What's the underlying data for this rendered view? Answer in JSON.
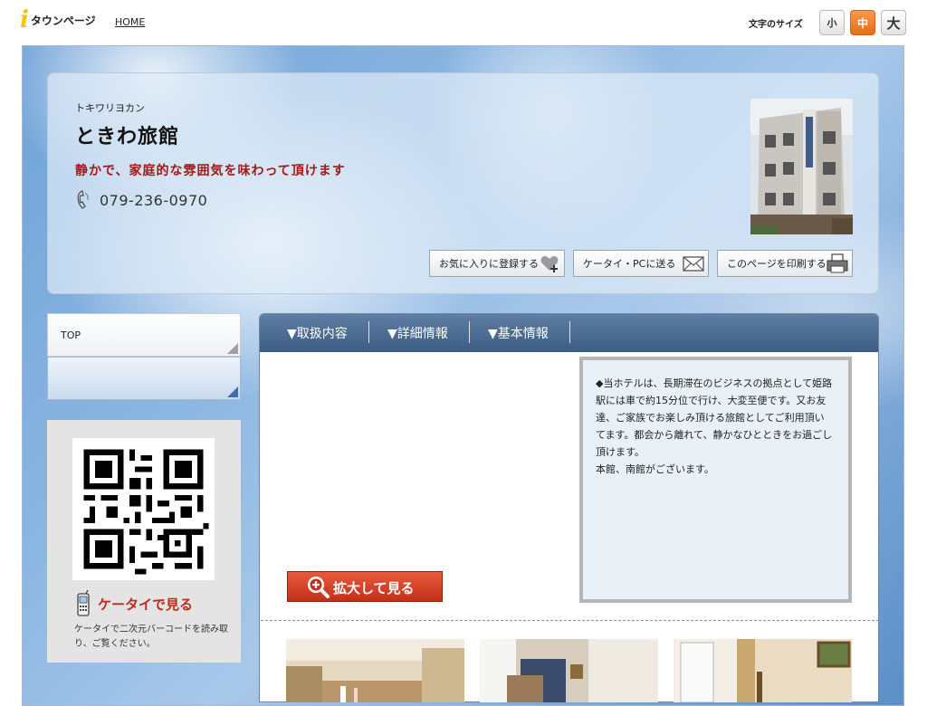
{
  "topbar": {
    "logo_text": "タウンページ",
    "home_label": "HOME",
    "font_size_label": "文字のサイズ",
    "font_sizes": [
      "小",
      "中",
      "大"
    ]
  },
  "shop": {
    "kana": "トキワリヨカン",
    "name": "ときわ旅館",
    "catchphrase": "静かで、家庭的な雰囲気を味わって頂けます",
    "phone": "079-236-0970"
  },
  "actions": {
    "favorite_label": "お気に入りに登録する",
    "send_label": "ケータイ・PCに送る",
    "print_label": "このページを印刷する"
  },
  "sidenav": {
    "top_label": "TOP"
  },
  "keitai": {
    "title": "ケータイで見る",
    "description": "ケータイで二次元バーコードを読み取り、ご覧ください。"
  },
  "tabs": [
    "▼取扱内容",
    "▼詳細情報",
    "▼基本情報"
  ],
  "main": {
    "zoom_label": "拡大して見る",
    "description": "◆当ホテルは、長期滞在のビジネスの拠点として姫路駅には車で約15分位で行け、大変至便です。又お友達、ご家族でお楽しみ頂ける旅館としてご利用頂いてます。都会から離れて、静かなひとときをお過ごし頂けます。\n本館、南館がございます。"
  },
  "colors": {
    "accent_orange": "#e86d16",
    "catch_red": "#a51818",
    "tab_blue": "#3c5c82"
  }
}
